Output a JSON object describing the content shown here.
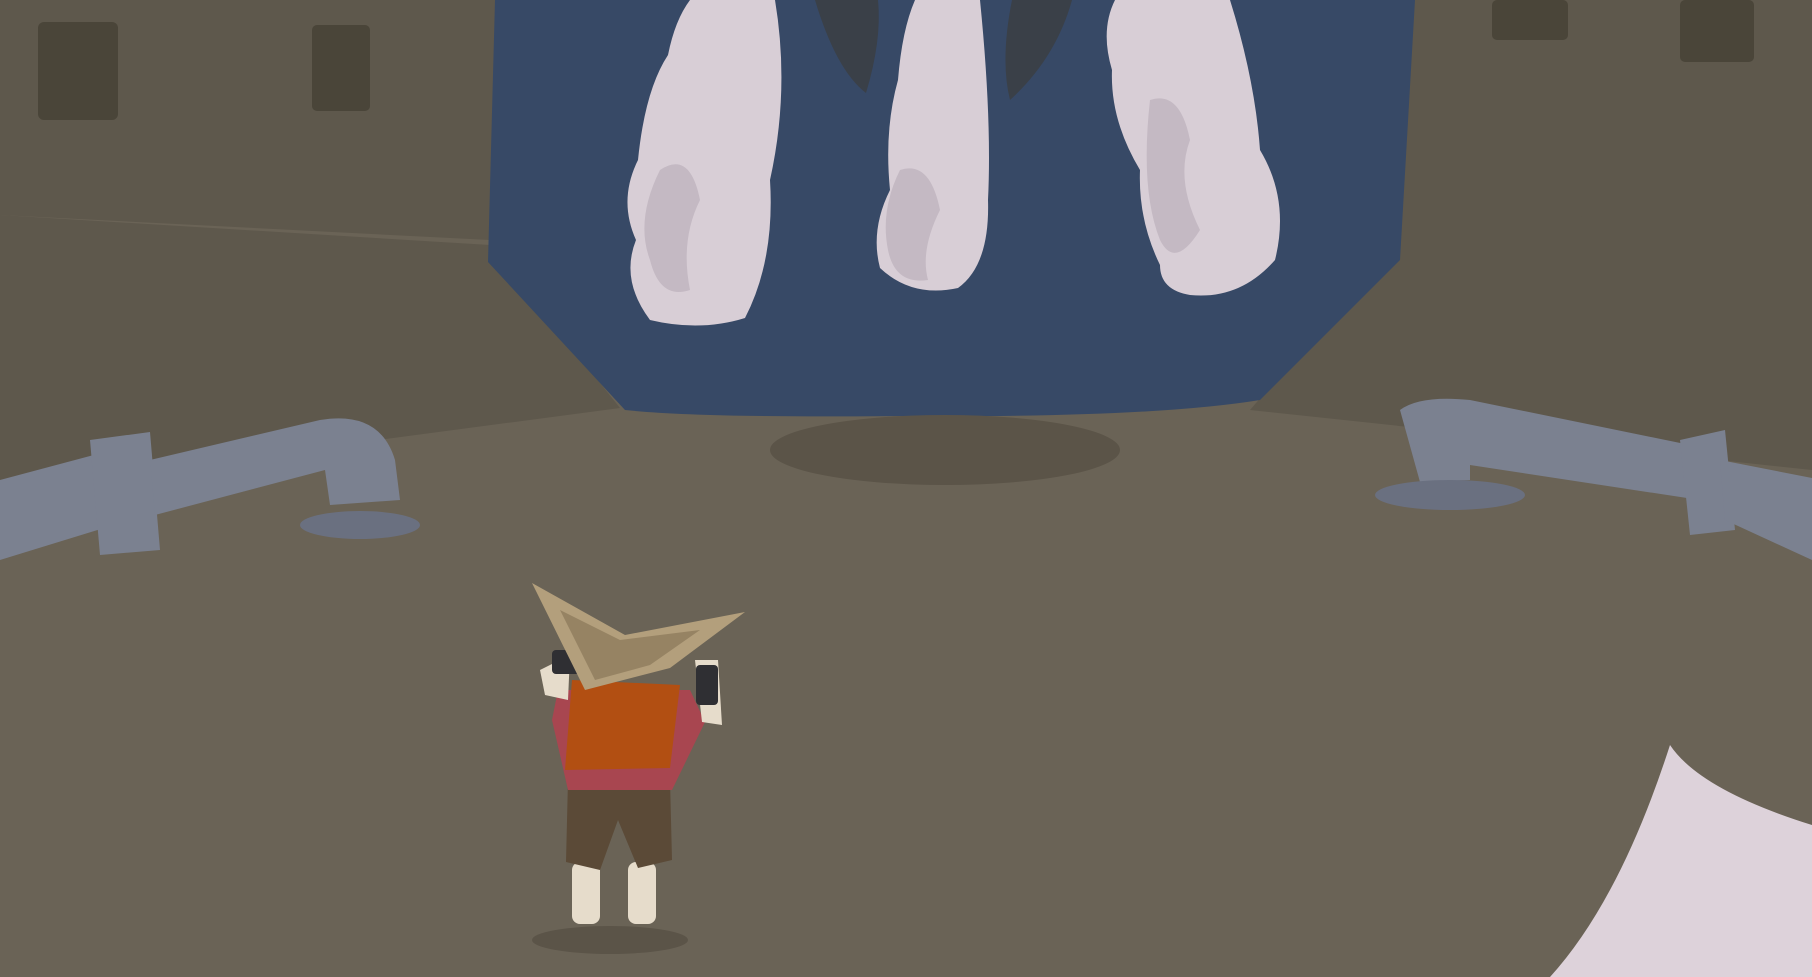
{
  "scene": {
    "colors": {
      "wall": "#5e584c",
      "wall_dark": "#4a4539",
      "floor": "#6a6356",
      "floor_shadow": "#5b5448",
      "door": "#374966",
      "smoke": "#d8ced6",
      "smoke_shade": "#c4b9c3",
      "fang": "#3a4048",
      "fang_edge": "#2a2e33",
      "pipe": "#7b8190",
      "pipe_shade": "#6a7080",
      "hat": "#b39f7c",
      "hat_shade": "#968363",
      "shirt": "#b24f12",
      "shirt_sleeve": "#a84650",
      "pants": "#5b4a37",
      "skin": "#e6dccb",
      "glove": "#2f2f33",
      "foreground_blade": "#ddd2da"
    }
  }
}
